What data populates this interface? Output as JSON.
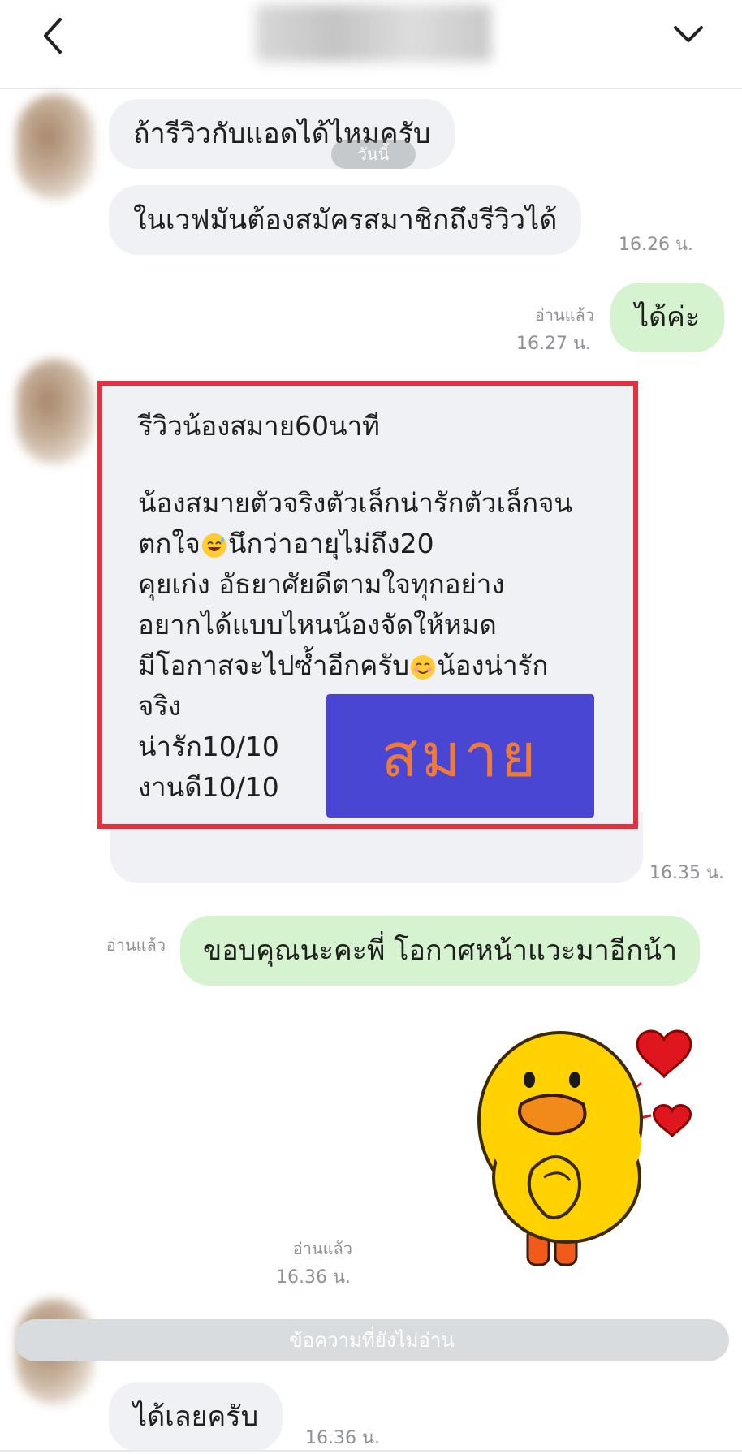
{
  "header": {
    "back_icon": "chevron-left-icon",
    "menu_icon": "chevron-down-icon"
  },
  "date_pill": {
    "label": "วันนี้"
  },
  "messages": {
    "in1": {
      "text": "ถ้ารีวิวกับแอดได้ไหมครับ"
    },
    "in2": {
      "text": "ในเวฟมันต้องสมัครสมาชิกถึงรีวิวได้",
      "time": "16.26 น."
    },
    "out1": {
      "text": "ได้ค่ะ",
      "read": "อ่านแล้ว",
      "time": "16.27 น."
    },
    "review": {
      "title": "รีวิวน้องสมาย60นาที",
      "line1": "น้องสมายตัวจริงตัวเล็กน่ารักตัวเล็กจน",
      "line2a": "ตกใจ",
      "line2b": "นึกว่าอายุไม่ถึง20",
      "line3": "คุยเก่ง อัธยาศัยดีตามใจทุกอย่าง",
      "line4": "อยากได้แบบไหนน้องจัดให้หมด",
      "line5a": "มีโอกาสจะไปซ้ำอีกครับ",
      "line5b": "น้องน่ารัก",
      "line6": "จริง",
      "line7": "น่ารัก10/10",
      "line8": "งานดี10/10",
      "stamp": "สมาย",
      "time": "16.35 น."
    },
    "out2": {
      "text": "ขอบคุณนะคะพี่ โอกาศหน้าแวะมาอีกน้า",
      "read": "อ่านแล้ว"
    },
    "sticker": {
      "icon": "duck-sticker-icon",
      "read": "อ่านแล้ว",
      "time": "16.36 น."
    },
    "unread_divider": "ข้อความที่ยังไม่อ่าน",
    "in3": {
      "text": "ได้เลยครับ",
      "time": "16.36 น."
    }
  },
  "colors": {
    "incoming_bubble": "#eff1f4",
    "outgoing_bubble": "#d6f3cf",
    "highlight_border": "#e5303f",
    "stamp_bg": "#4a46d4",
    "stamp_text": "#ee7a3c"
  }
}
